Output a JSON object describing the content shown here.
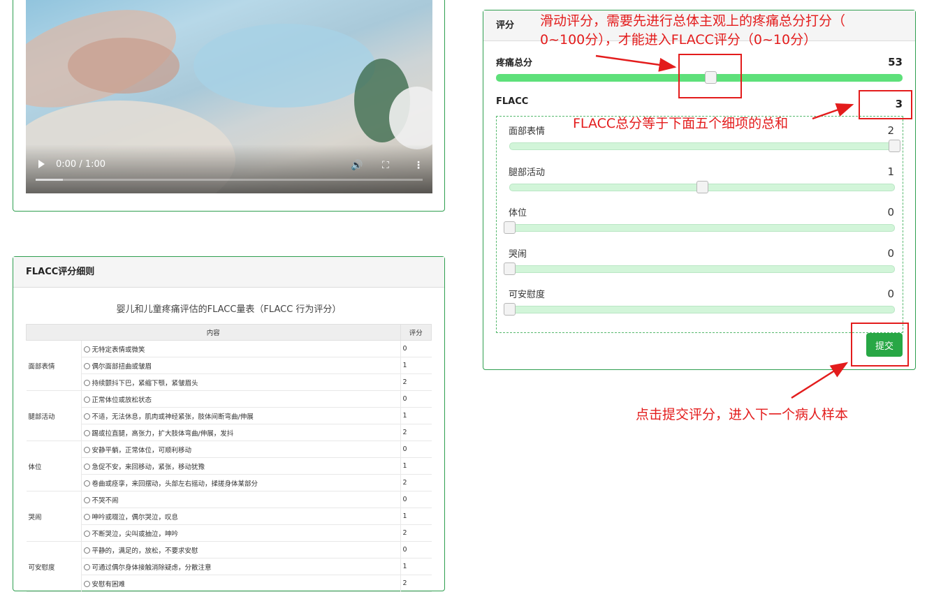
{
  "video": {
    "time_label": "0:00 / 1:00",
    "progress_fraction": 0.07
  },
  "rules": {
    "header": "FLACC评分细则",
    "table_title": "婴儿和儿童疼痛评估的FLACC量表（FLACC 行为评分）",
    "columns": [
      "内容",
      "评分"
    ],
    "categories": [
      {
        "name": "面部表情",
        "items": [
          {
            "text": "无特定表情或微笑",
            "score": "0"
          },
          {
            "text": "偶尔面部扭曲或皱眉",
            "score": "1"
          },
          {
            "text": "持续颤抖下巴，紧缩下颚，紧皱眉头",
            "score": "2"
          }
        ]
      },
      {
        "name": "腿部活动",
        "items": [
          {
            "text": "正常体位或放松状态",
            "score": "0"
          },
          {
            "text": "不适，无法休息，肌肉或神经紧张，肢体间断弯曲/伸展",
            "score": "1"
          },
          {
            "text": "踢或拉直腿，高张力，扩大肢体弯曲/伸展，发抖",
            "score": "2"
          }
        ]
      },
      {
        "name": "体位",
        "items": [
          {
            "text": "安静平躺，正常体位，可顺利移动",
            "score": "0"
          },
          {
            "text": "急促不安，来回移动，紧张，移动犹豫",
            "score": "1"
          },
          {
            "text": "卷曲或痉挛，来回摆动，头部左右摇动，揉搓身体某部分",
            "score": "2"
          }
        ]
      },
      {
        "name": "哭闹",
        "items": [
          {
            "text": "不哭不闹",
            "score": "0"
          },
          {
            "text": "呻吟或啜泣，偶尔哭泣，叹息",
            "score": "1"
          },
          {
            "text": "不断哭泣，尖叫或抽泣，呻吟",
            "score": "2"
          }
        ]
      },
      {
        "name": "可安慰度",
        "items": [
          {
            "text": "平静的，满足的，放松，不要求安慰",
            "score": "0"
          },
          {
            "text": "可通过偶尔身体接触消除疑虑，分散注意",
            "score": "1"
          },
          {
            "text": "安慰有困难",
            "score": "2"
          }
        ]
      }
    ]
  },
  "scoring": {
    "header": "评分",
    "total_label": "疼痛总分",
    "total_value": "53",
    "total_fraction": 0.53,
    "flacc_label": "FLACC",
    "flacc_value": "3",
    "items": [
      {
        "label": "面部表情",
        "value": "2",
        "fraction": 1.0
      },
      {
        "label": "腿部活动",
        "value": "1",
        "fraction": 0.5
      },
      {
        "label": "体位",
        "value": "0",
        "fraction": 0.0
      },
      {
        "label": "哭闹",
        "value": "0",
        "fraction": 0.0
      },
      {
        "label": "可安慰度",
        "value": "0",
        "fraction": 0.0
      }
    ],
    "submit_label": "提交",
    "accent_color": "#28a745",
    "total_track_color": "#5ee07a",
    "item_track_color": "#d2f5d9"
  },
  "annotations": {
    "slider_note_line1": "滑动评分，需要先进行总体主观上的疼痛总分打分（",
    "slider_note_line2": "0~100分），才能进入FLACC评分（0~10分）",
    "flacc_note": "FLACC总分等于下面五个细项的总和",
    "submit_note": "点击提交评分，进入下一个病人样本",
    "color": "#e31c1c"
  }
}
